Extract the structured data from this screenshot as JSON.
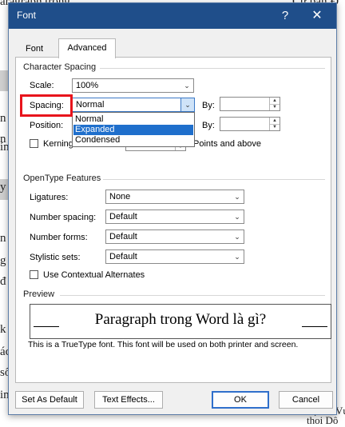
{
  "background_doc": {
    "left_fragments": [
      "aragraph trong",
      "n",
      "n",
      "ín",
      "y",
      "n",
      "g",
      "đ",
      "k",
      "ác",
      "số",
      "in"
    ],
    "right_fragments": [
      "Cứ bạn Đ",
      "Họt đà Vứ",
      "thoi Dô"
    ]
  },
  "dialog": {
    "title": "Font",
    "help_glyph": "?",
    "close_glyph": "✕",
    "tabs": {
      "font": "Font",
      "advanced": "Advanced"
    },
    "character_spacing": {
      "group_title": "Character Spacing",
      "scale_label": "Scale:",
      "scale_value": "100%",
      "spacing_label": "Spacing:",
      "spacing_value": "Normal",
      "spacing_options": [
        "Normal",
        "Expanded",
        "Condensed"
      ],
      "spacing_selected_option": "Expanded",
      "by_label_1": "By:",
      "position_label": "Position:",
      "by_label_2": "By:",
      "kerning_label": "Kerning for fonts:",
      "points_label": "Points and above"
    },
    "opentype": {
      "group_title": "OpenType Features",
      "ligatures_label": "Ligatures:",
      "ligatures_value": "None",
      "number_spacing_label": "Number spacing:",
      "number_spacing_value": "Default",
      "number_forms_label": "Number forms:",
      "number_forms_value": "Default",
      "stylistic_sets_label": "Stylistic sets:",
      "stylistic_sets_value": "Default",
      "contextual_label": "Use Contextual Alternates"
    },
    "preview": {
      "group_title": "Preview",
      "sample_text": "Paragraph trong Word là gì?",
      "note": "This is a TrueType font. This font will be used on both printer and screen."
    },
    "buttons": {
      "set_default": "Set As Default",
      "text_effects": "Text Effects...",
      "ok": "OK",
      "cancel": "Cancel"
    }
  },
  "colors": {
    "title_bar": "#1f4e8a",
    "highlight_box": "#e8141c",
    "selected_option": "#1f6fcc"
  }
}
